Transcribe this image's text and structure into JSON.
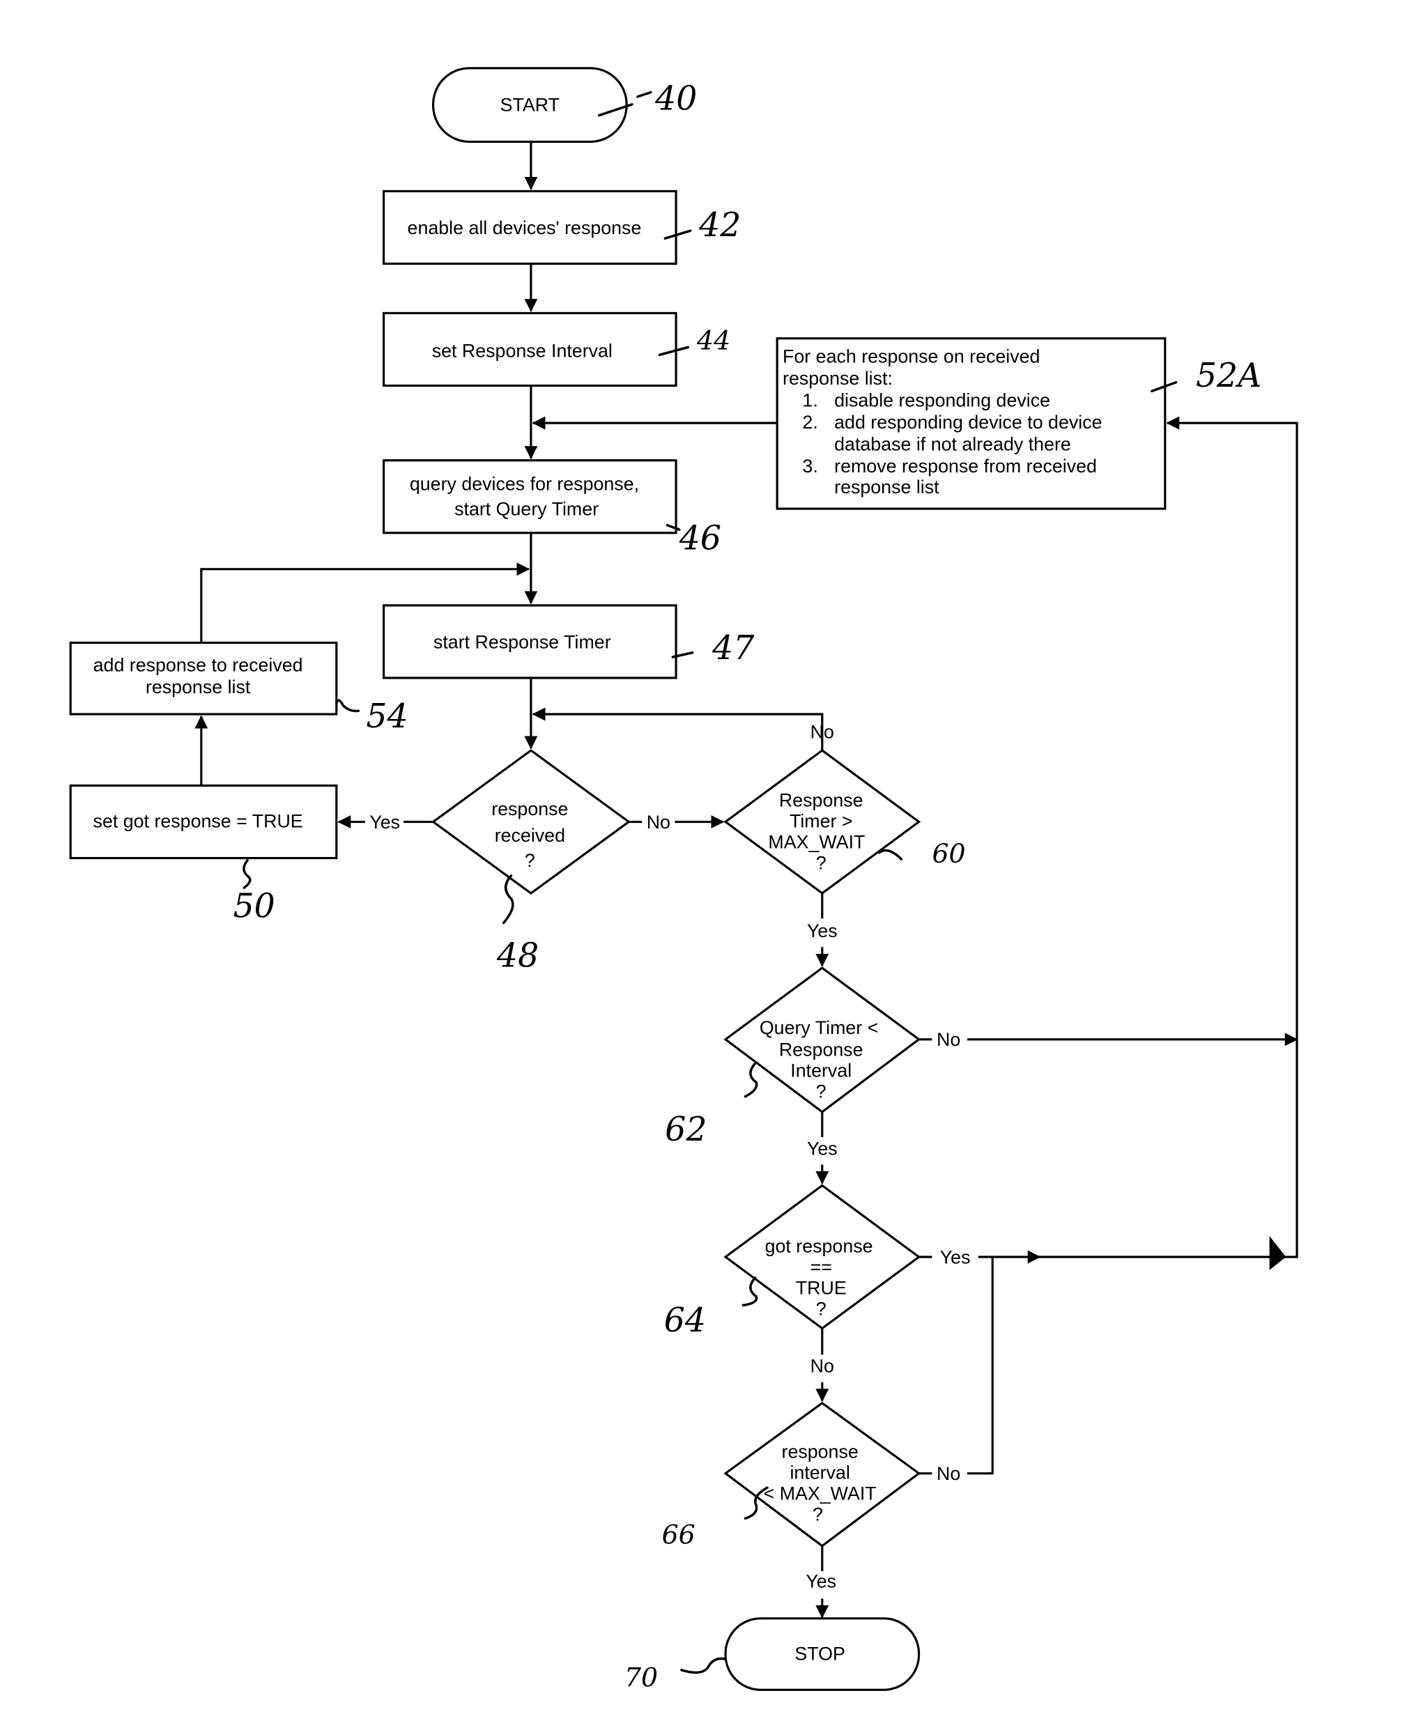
{
  "diagram": {
    "type": "flowchart",
    "nodes": {
      "start": {
        "label": "START",
        "ref": "40"
      },
      "enable": {
        "label": "enable all devices' response",
        "ref": "42"
      },
      "set_interval": {
        "label": "set Response Interval",
        "ref": "44"
      },
      "query": {
        "lines": [
          "query devices for response,",
          "start Query Timer"
        ],
        "ref": "46"
      },
      "start_timer": {
        "label": "start Response Timer",
        "ref": "47"
      },
      "response_received": {
        "lines": [
          "response",
          "received",
          "?"
        ],
        "ref": "48"
      },
      "set_got": {
        "label": "set got response = TRUE",
        "ref": "50"
      },
      "add_response": {
        "lines": [
          "add response to received",
          "response list"
        ],
        "ref": "54"
      },
      "process_list": {
        "lines": [
          "For each response on received",
          "response list:"
        ],
        "items": [
          {
            "num": "1.",
            "lines": [
              "disable responding device"
            ]
          },
          {
            "num": "2.",
            "lines": [
              "add responding device to device",
              "database if not already there"
            ]
          },
          {
            "num": "3.",
            "lines": [
              "remove response from received",
              "response list"
            ]
          }
        ],
        "ref": "52A"
      },
      "timer_check": {
        "lines": [
          "Response",
          "Timer >",
          "MAX_WAIT",
          "?"
        ],
        "ref": "60"
      },
      "query_check": {
        "lines": [
          "Query Timer <",
          "Response",
          "Interval",
          "?"
        ],
        "ref": "62"
      },
      "got_check": {
        "lines": [
          "got response",
          "==",
          "TRUE",
          "?"
        ],
        "ref": "64"
      },
      "interval_check": {
        "lines": [
          "response",
          "interval",
          "< MAX_WAIT",
          "?"
        ],
        "ref": "66"
      },
      "stop": {
        "label": "STOP",
        "ref": "70"
      }
    },
    "edge_labels": {
      "received_yes": "Yes",
      "received_no": "No",
      "timer_no": "No",
      "timer_yes": "Yes",
      "query_no": "No",
      "query_yes": "Yes",
      "got_yes": "Yes",
      "got_no": "No",
      "interval_no": "No",
      "interval_yes": "Yes"
    }
  }
}
